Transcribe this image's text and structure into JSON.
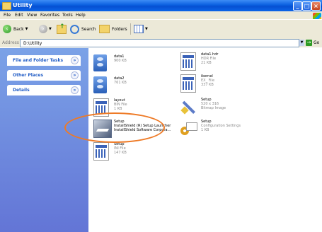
{
  "window": {
    "title": "Utility"
  },
  "menu": [
    "File",
    "Edit",
    "View",
    "Favorites",
    "Tools",
    "Help"
  ],
  "toolbar": {
    "back": "Back",
    "search": "Search",
    "folders": "Folders"
  },
  "address": {
    "label": "Address",
    "value": "D:\\Utility",
    "go": "Go"
  },
  "taskpane": {
    "panels": [
      "File and Folder Tasks",
      "Other Places",
      "Details"
    ]
  },
  "files": [
    {
      "name": "data1",
      "type": "",
      "size": "900 KB",
      "icon": "cab-file-icon"
    },
    {
      "name": "data1.hdr",
      "type": "HDR File",
      "size": "21 KB",
      "icon": "hdr-file-icon"
    },
    {
      "name": "data2",
      "type": "",
      "size": "761 KB",
      "icon": "cab-file-icon"
    },
    {
      "name": "ikernel",
      "type": "EX_ File",
      "size": "337 KB",
      "icon": "ex-file-icon"
    },
    {
      "name": "layout",
      "type": "BIN File",
      "size": "1 KB",
      "icon": "bin-file-icon"
    },
    {
      "name": "Setup",
      "type": "520 x 316",
      "size": "Bitmap Image",
      "icon": "bitmap-icon"
    },
    {
      "name": "Setup",
      "type": "InstallShield (R) Setup Launcher",
      "size": "InstallShield Software Corpora...",
      "icon": "installshield-launcher-icon"
    },
    {
      "name": "Setup",
      "type": "Configuration Settings",
      "size": "1 KB",
      "icon": "config-settings-icon"
    },
    {
      "name": "Setup",
      "type": "INI File",
      "size": "147 KB",
      "icon": "ini-file-icon"
    }
  ],
  "colors": {
    "highlight": "#ee7a26",
    "titlebar": "#0a5fe0",
    "taskpane": "#6f8fe0"
  }
}
